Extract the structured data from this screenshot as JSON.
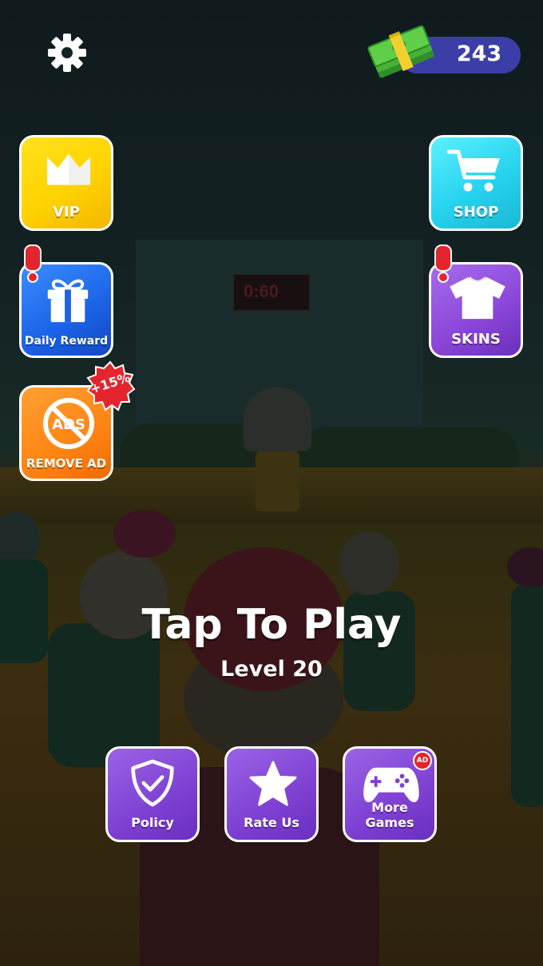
{
  "hud": {
    "money": "243",
    "settings_icon": "gear-icon",
    "money_icon": "cash-stack-icon"
  },
  "left_buttons": {
    "vip": {
      "label": "VIP",
      "icon": "crown-icon",
      "color": "#ffd300"
    },
    "daily_reward": {
      "label": "Daily Reward",
      "icon": "gift-icon",
      "color": "#1b62e6",
      "alert": "!"
    },
    "remove_ad": {
      "label": "REMOVE AD",
      "icon": "no-ads-icon",
      "icon_text": "ADS",
      "color": "#ff8512",
      "bonus_badge": "+15%"
    }
  },
  "right_buttons": {
    "shop": {
      "label": "SHOP",
      "icon": "cart-icon",
      "color": "#27d3ee"
    },
    "skins": {
      "label": "SKINS",
      "icon": "shirt-icon",
      "color": "#8a45d8",
      "alert": "!"
    }
  },
  "center": {
    "title": "Tap To Play",
    "level": "Level 20"
  },
  "bottom_buttons": [
    {
      "label": "Policy",
      "icon": "shield-check-icon"
    },
    {
      "label": "Rate Us",
      "icon": "star-icon"
    },
    {
      "label": "More Games",
      "icon": "gamepad-icon",
      "badge": "AD"
    }
  ],
  "colors": {
    "accent_purple": "#7e40d2",
    "money_pill": "#3b3ea7",
    "alert_red": "#e3262e"
  }
}
